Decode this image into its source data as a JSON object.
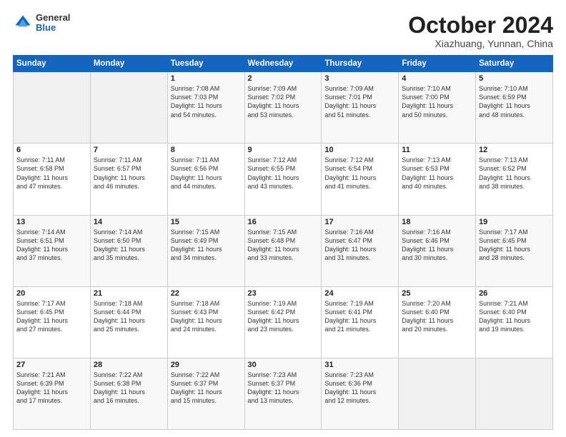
{
  "header": {
    "logo_general": "General",
    "logo_blue": "Blue",
    "month_title": "October 2024",
    "location": "Xiazhuang, Yunnan, China"
  },
  "weekdays": [
    "Sunday",
    "Monday",
    "Tuesday",
    "Wednesday",
    "Thursday",
    "Friday",
    "Saturday"
  ],
  "weeks": [
    [
      {
        "day": "",
        "info": ""
      },
      {
        "day": "",
        "info": ""
      },
      {
        "day": "1",
        "info": "Sunrise: 7:08 AM\nSunset: 7:03 PM\nDaylight: 11 hours\nand 54 minutes."
      },
      {
        "day": "2",
        "info": "Sunrise: 7:09 AM\nSunset: 7:02 PM\nDaylight: 11 hours\nand 53 minutes."
      },
      {
        "day": "3",
        "info": "Sunrise: 7:09 AM\nSunset: 7:01 PM\nDaylight: 11 hours\nand 51 minutes."
      },
      {
        "day": "4",
        "info": "Sunrise: 7:10 AM\nSunset: 7:00 PM\nDaylight: 11 hours\nand 50 minutes."
      },
      {
        "day": "5",
        "info": "Sunrise: 7:10 AM\nSunset: 6:59 PM\nDaylight: 11 hours\nand 48 minutes."
      }
    ],
    [
      {
        "day": "6",
        "info": "Sunrise: 7:11 AM\nSunset: 6:58 PM\nDaylight: 11 hours\nand 47 minutes."
      },
      {
        "day": "7",
        "info": "Sunrise: 7:11 AM\nSunset: 6:57 PM\nDaylight: 11 hours\nand 46 minutes."
      },
      {
        "day": "8",
        "info": "Sunrise: 7:11 AM\nSunset: 6:56 PM\nDaylight: 11 hours\nand 44 minutes."
      },
      {
        "day": "9",
        "info": "Sunrise: 7:12 AM\nSunset: 6:55 PM\nDaylight: 11 hours\nand 43 minutes."
      },
      {
        "day": "10",
        "info": "Sunrise: 7:12 AM\nSunset: 6:54 PM\nDaylight: 11 hours\nand 41 minutes."
      },
      {
        "day": "11",
        "info": "Sunrise: 7:13 AM\nSunset: 6:53 PM\nDaylight: 11 hours\nand 40 minutes."
      },
      {
        "day": "12",
        "info": "Sunrise: 7:13 AM\nSunset: 6:52 PM\nDaylight: 11 hours\nand 38 minutes."
      }
    ],
    [
      {
        "day": "13",
        "info": "Sunrise: 7:14 AM\nSunset: 6:51 PM\nDaylight: 11 hours\nand 37 minutes."
      },
      {
        "day": "14",
        "info": "Sunrise: 7:14 AM\nSunset: 6:50 PM\nDaylight: 11 hours\nand 35 minutes."
      },
      {
        "day": "15",
        "info": "Sunrise: 7:15 AM\nSunset: 6:49 PM\nDaylight: 11 hours\nand 34 minutes."
      },
      {
        "day": "16",
        "info": "Sunrise: 7:15 AM\nSunset: 6:48 PM\nDaylight: 11 hours\nand 33 minutes."
      },
      {
        "day": "17",
        "info": "Sunrise: 7:16 AM\nSunset: 6:47 PM\nDaylight: 11 hours\nand 31 minutes."
      },
      {
        "day": "18",
        "info": "Sunrise: 7:16 AM\nSunset: 6:46 PM\nDaylight: 11 hours\nand 30 minutes."
      },
      {
        "day": "19",
        "info": "Sunrise: 7:17 AM\nSunset: 6:45 PM\nDaylight: 11 hours\nand 28 minutes."
      }
    ],
    [
      {
        "day": "20",
        "info": "Sunrise: 7:17 AM\nSunset: 6:45 PM\nDaylight: 11 hours\nand 27 minutes."
      },
      {
        "day": "21",
        "info": "Sunrise: 7:18 AM\nSunset: 6:44 PM\nDaylight: 11 hours\nand 25 minutes."
      },
      {
        "day": "22",
        "info": "Sunrise: 7:18 AM\nSunset: 6:43 PM\nDaylight: 11 hours\nand 24 minutes."
      },
      {
        "day": "23",
        "info": "Sunrise: 7:19 AM\nSunset: 6:42 PM\nDaylight: 11 hours\nand 23 minutes."
      },
      {
        "day": "24",
        "info": "Sunrise: 7:19 AM\nSunset: 6:41 PM\nDaylight: 11 hours\nand 21 minutes."
      },
      {
        "day": "25",
        "info": "Sunrise: 7:20 AM\nSunset: 6:40 PM\nDaylight: 11 hours\nand 20 minutes."
      },
      {
        "day": "26",
        "info": "Sunrise: 7:21 AM\nSunset: 6:40 PM\nDaylight: 11 hours\nand 19 minutes."
      }
    ],
    [
      {
        "day": "27",
        "info": "Sunrise: 7:21 AM\nSunset: 6:39 PM\nDaylight: 11 hours\nand 17 minutes."
      },
      {
        "day": "28",
        "info": "Sunrise: 7:22 AM\nSunset: 6:38 PM\nDaylight: 11 hours\nand 16 minutes."
      },
      {
        "day": "29",
        "info": "Sunrise: 7:22 AM\nSunset: 6:37 PM\nDaylight: 11 hours\nand 15 minutes."
      },
      {
        "day": "30",
        "info": "Sunrise: 7:23 AM\nSunset: 6:37 PM\nDaylight: 11 hours\nand 13 minutes."
      },
      {
        "day": "31",
        "info": "Sunrise: 7:23 AM\nSunset: 6:36 PM\nDaylight: 11 hours\nand 12 minutes."
      },
      {
        "day": "",
        "info": ""
      },
      {
        "day": "",
        "info": ""
      }
    ]
  ]
}
